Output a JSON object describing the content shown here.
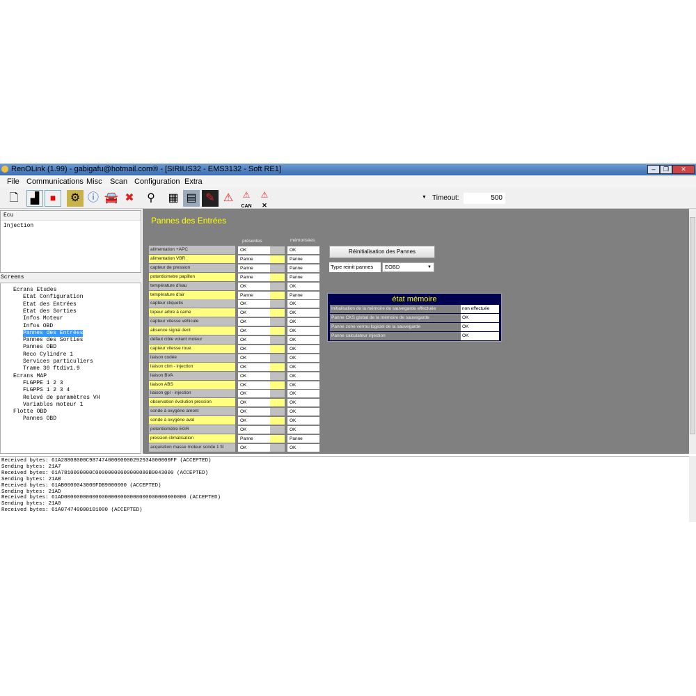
{
  "window": {
    "title": "RenOLink (1.99) - gabigafu@hotmail.com® -  [SIRIUS32 - EMS3132 - Soft RE1]"
  },
  "menu": [
    "File",
    "Communications",
    "Misc",
    "Scan",
    "Configuration",
    "Extra"
  ],
  "toolbar": {
    "timeout_label": "Timeout:",
    "timeout_value": "500",
    "can_label": "CAN"
  },
  "ecu": {
    "header": "Ecu",
    "items": [
      "Injection"
    ]
  },
  "screens": {
    "label": "Screens",
    "tree": [
      {
        "t": "Ecrans Etudes",
        "l": 0
      },
      {
        "t": "Etat Configuration",
        "l": 1
      },
      {
        "t": "Etat des Entrées",
        "l": 1
      },
      {
        "t": "Etat des Sorties",
        "l": 1
      },
      {
        "t": "Infos Moteur",
        "l": 1
      },
      {
        "t": "Infos OBD",
        "l": 1
      },
      {
        "t": "Pannes des Entrées",
        "l": 1,
        "sel": true
      },
      {
        "t": "Pannes des Sorties",
        "l": 1
      },
      {
        "t": "Pannes OBD",
        "l": 1
      },
      {
        "t": "Reco Cylindre 1",
        "l": 1
      },
      {
        "t": "Services particuliers",
        "l": 1
      },
      {
        "t": "Trame 30 ftdiv1.9",
        "l": 1
      },
      {
        "t": "Ecrans MAP",
        "l": 0
      },
      {
        "t": "FLGPPE 1 2 3",
        "l": 1
      },
      {
        "t": "FLGPPS 1 2 3 4",
        "l": 1
      },
      {
        "t": "Relevé de paramètres VH",
        "l": 1
      },
      {
        "t": "Variables moteur 1",
        "l": 1
      },
      {
        "t": "Flotte OBD",
        "l": 0
      },
      {
        "t": "Pannes OBD",
        "l": 1
      }
    ]
  },
  "panel": {
    "title": "Pannes des Entrées",
    "col_present": "présentes",
    "col_memo": "mémorisées",
    "rows": [
      [
        "alimentation +APC",
        "OK",
        "OK"
      ],
      [
        "alimentation VBR",
        "Panne",
        "Panne"
      ],
      [
        "capteur de pression",
        "Panne",
        "Panne"
      ],
      [
        "potentiometre papillon",
        "Panne",
        "Panne"
      ],
      [
        "température d'eau",
        "OK",
        "OK"
      ],
      [
        "température d'air",
        "Panne",
        "Panne"
      ],
      [
        "capteur cliquetis",
        "OK",
        "OK"
      ],
      [
        "topeur arbre à came",
        "OK",
        "OK"
      ],
      [
        "capteur vitesse véhicule",
        "OK",
        "OK"
      ],
      [
        "absence signal dent",
        "OK",
        "OK"
      ],
      [
        "défaut cible volant moteur",
        "OK",
        "OK"
      ],
      [
        "capteur vitesse roue",
        "OK",
        "OK"
      ],
      [
        "liaison codée",
        "OK",
        "OK"
      ],
      [
        "liaison clim - injection",
        "OK",
        "OK"
      ],
      [
        "liaison BVA",
        "OK",
        "OK"
      ],
      [
        "liaison ABS",
        "OK",
        "OK"
      ],
      [
        "liaison gpl - injection",
        "OK",
        "OK"
      ],
      [
        "observation évolution pression",
        "OK",
        "OK"
      ],
      [
        "sonde à oxygène amont",
        "OK",
        "OK"
      ],
      [
        "sonde à oxygène aval",
        "OK",
        "OK"
      ],
      [
        "potentiomètre EGR",
        "OK",
        "OK"
      ],
      [
        "pression climatisation",
        "Panne",
        "Panne"
      ],
      [
        "acquisition masse moteur sonde 1 fil",
        "OK",
        "OK"
      ]
    ],
    "reset_button": "Réinitialisation des Pannes",
    "type_label": "Type reinit pannes",
    "type_value": "EOBD",
    "memory": {
      "title": "état mémoire",
      "rows": [
        [
          "Initialisation de la mémoire de sauvegarde effectuée",
          "non effectuée"
        ],
        [
          "Panne CKS global de la mémoire de sauvegarde",
          "OK"
        ],
        [
          "Panne zone verrou logiciel de la sauvegarde",
          "OK"
        ],
        [
          "Panne calculateur injection",
          "OK"
        ]
      ]
    }
  },
  "colors": {
    "yellow": "#ffff80",
    "gray": "#c0c0c0",
    "panel": "#808080",
    "navy": "#000050"
  },
  "log": [
    "Received bytes: 61A28808000C98747400000000292934000000FF  (ACCEPTED)",
    "Sending bytes: 21A7",
    "Received bytes: 61A7810000000C00000000000000080B9043000  (ACCEPTED)",
    "Sending bytes: 21AB",
    "Received bytes: 61AB0000043000FDB9000000  (ACCEPTED)",
    "Sending bytes: 21AD",
    "Received bytes: 61AD000000000000000000000000000000000000000  (ACCEPTED)",
    "Sending bytes: 21A0",
    "Received bytes: 61A074740000101000  (ACCEPTED)"
  ]
}
